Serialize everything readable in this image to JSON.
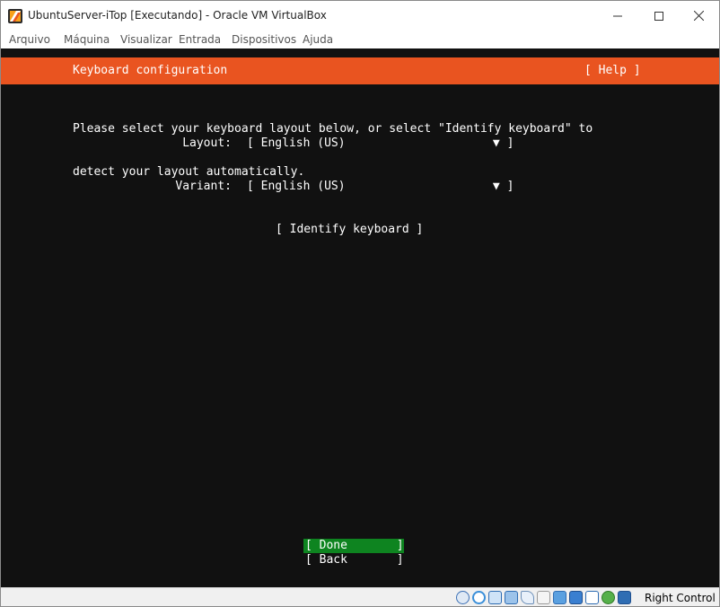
{
  "window": {
    "title": "UbuntuServer-iTop [Executando] - Oracle VM VirtualBox"
  },
  "menubar": {
    "items": [
      "Arquivo",
      "Máquina",
      "Visualizar",
      "Entrada",
      "Dispositivos",
      "Ajuda"
    ]
  },
  "installer": {
    "header_title": "Keyboard configuration",
    "help_label": "[ Help ]",
    "description_line1": "Please select your keyboard layout below, or select \"Identify keyboard\" to",
    "description_line2": "detect your layout automatically.",
    "layout_label": "Layout:",
    "layout_value": "[ English (US)                     ▼ ]",
    "variant_label": "Variant:",
    "variant_value": "[ English (US)                     ▼ ]",
    "identify_label": "[ Identify keyboard ]",
    "done_label": "[ Done       ]",
    "back_label": "[ Back       ]"
  },
  "statusbar": {
    "icons": [
      "hard-disk-icon",
      "optical-drive-icon",
      "audio-icon",
      "network-icon",
      "usb-icon",
      "shared-folders-icon",
      "display-icon",
      "recording-icon",
      "vt-x-icon",
      "guest-additions-icon",
      "mouse-integration-icon"
    ],
    "host_key": "Right Control"
  },
  "colors": {
    "accent": "#e95420",
    "button_selected": "#0e8420",
    "terminal_bg": "#111111"
  }
}
